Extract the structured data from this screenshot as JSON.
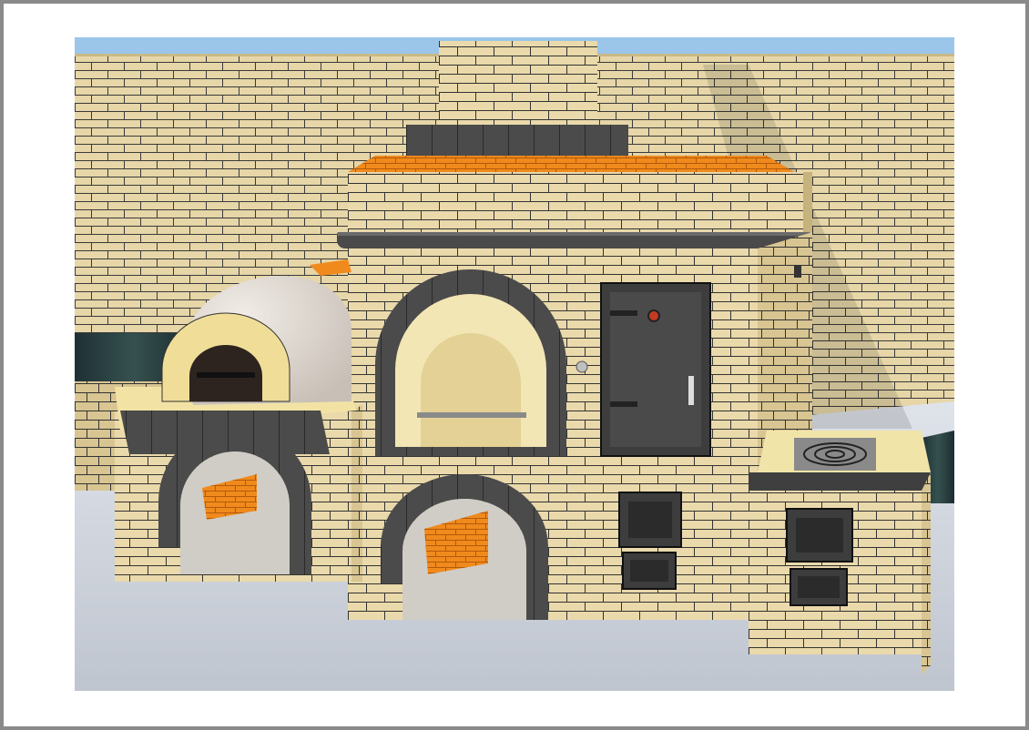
{
  "image": {
    "subject": "outdoor-brick-oven-complex-render",
    "colors": {
      "frame_border": "#8a8a8a",
      "page_background": "#ffffff",
      "sky": "#9bc6ea",
      "brick_fill": "#e6d6a8",
      "mortar": "#3a3a3a",
      "dark_brick": "#4b4b4b",
      "fire_brick": "#f08a1c",
      "dome_plaster": "#ddd6d0",
      "ground": "#c9cfd8",
      "countertop": "#23343a",
      "cast_iron": "#3d3d3d"
    },
    "components": [
      "brick-back-wall",
      "chimney",
      "plastered-dome-pizza-oven",
      "pizza-oven-mouth",
      "arched-firebox-opening",
      "cast-iron-oven-door",
      "cooking-stove-hob",
      "ash-pit-doors",
      "arched-wood-storage-niches",
      "stone-countertops"
    ]
  }
}
